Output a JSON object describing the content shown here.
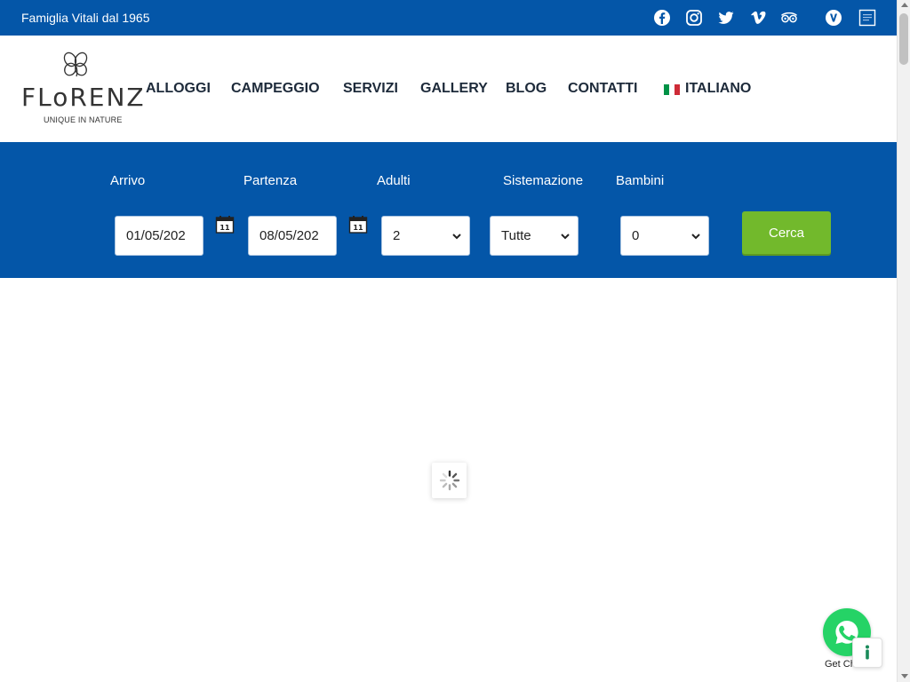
{
  "topbar": {
    "tagline": "Famiglia Vitali dal 1965",
    "bg_color": "#0456a8",
    "social": [
      "facebook-icon",
      "instagram-icon",
      "twitter-icon",
      "vimeo-icon",
      "tripadvisor-icon",
      "v-badge-icon",
      "qr-badge-icon"
    ]
  },
  "logo": {
    "wordmark": "FLoRENZ",
    "subtitle": "UNIQUE IN NATURE"
  },
  "nav": {
    "items": [
      "ALLOGGI",
      "CAMPEGGIO",
      "SERVIZI",
      "GALLERY",
      "BLOG",
      "CONTATTI"
    ],
    "language": "ITALIANO",
    "text_color": "#1d2a3a"
  },
  "booking": {
    "bg_color": "#0456a8",
    "labels": {
      "arrival": "Arrivo",
      "departure": "Partenza",
      "adults": "Adulti",
      "accommodation": "Sistemazione",
      "children": "Bambini"
    },
    "values": {
      "arrival": "01/05/202",
      "departure": "08/05/202",
      "adults": "2",
      "accommodation": "Tutte",
      "children": "0"
    },
    "calendar_day": "11",
    "search_label": "Cerca",
    "search_color": "#72b92c"
  },
  "chat": {
    "label": "Get Chat",
    "color": "#25d366"
  }
}
